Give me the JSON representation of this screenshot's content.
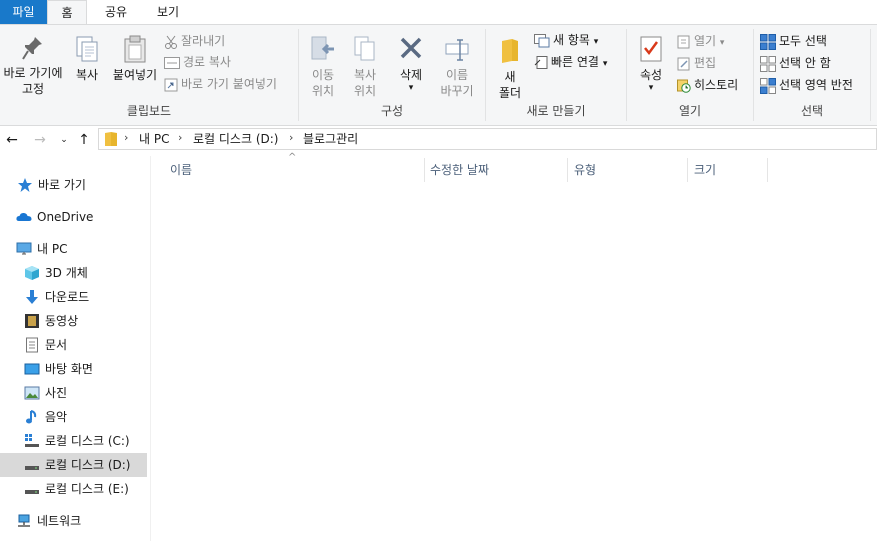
{
  "tabs": {
    "file": "파일",
    "home": "홈",
    "share": "공유",
    "view": "보기"
  },
  "clipboard": {
    "pin": "바로 가기에\n고정",
    "copy": "복사",
    "paste": "붙여넣기",
    "cut": "잘라내기",
    "copy_path": "경로 복사",
    "paste_shortcut": "바로 가기 붙여넣기",
    "label": "클립보드"
  },
  "organize": {
    "move_to": "이동\n위치",
    "copy_to": "복사\n위치",
    "delete": "삭제",
    "rename": "이름\n바꾸기",
    "label": "구성"
  },
  "new": {
    "new_folder": "새\n폴더",
    "new_item": "새 항목",
    "easy_access": "빠른 연결",
    "label": "새로 만들기"
  },
  "open": {
    "properties": "속성",
    "open": "열기",
    "edit": "편집",
    "history": "히스토리",
    "label": "열기"
  },
  "select": {
    "select_all": "모두 선택",
    "select_none": "선택 안 함",
    "invert": "선택 영역 반전",
    "label": "선택"
  },
  "breadcrumb": [
    "내 PC",
    "로컬 디스크 (D:)",
    "블로그관리"
  ],
  "nav": {
    "quick_access": "바로 가기",
    "onedrive": "OneDrive",
    "this_pc": "내 PC",
    "objects3d": "3D 개체",
    "downloads": "다운로드",
    "videos": "동영상",
    "documents": "문서",
    "desktop": "바탕 화면",
    "pictures": "사진",
    "music": "음악",
    "disk_c": "로컬 디스크 (C:)",
    "disk_d": "로컬 디스크 (D:)",
    "disk_e": "로컬 디스크 (E:)",
    "network": "네트워크"
  },
  "columns": {
    "name": "이름",
    "modified": "수정한 날짜",
    "type": "유형",
    "size": "크기"
  },
  "colors": {
    "accent": "#1979ca",
    "ribbon_bg": "#f5f6f7",
    "selected_bg": "#d9d9d9"
  }
}
